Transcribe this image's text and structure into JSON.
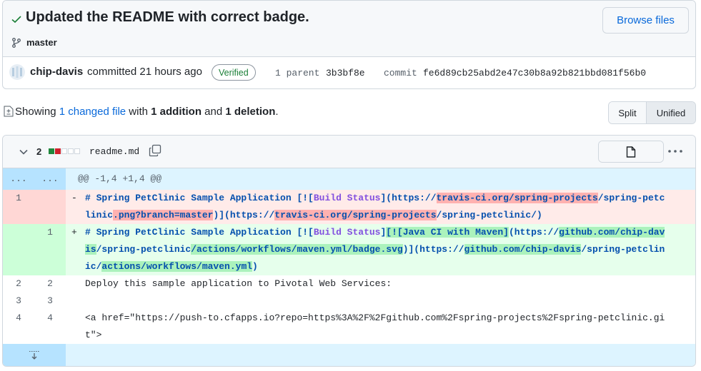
{
  "commit": {
    "title": "Updated the README with correct badge.",
    "browse_label": "Browse files",
    "branch": "master",
    "author": "chip-davis",
    "committed_text": "committed 21 hours ago",
    "verified_label": "Verified",
    "parent_label": "1 parent",
    "parent_sha": "3b3bf8e",
    "commit_label": "commit",
    "commit_sha": "fe6d89cb25abd2e47c30b8a92b821bbd081f56b0"
  },
  "summary": {
    "showing": "Showing",
    "changed_files": "1 changed file",
    "with": "with",
    "additions": "1 addition",
    "and": "and",
    "deletions": "1 deletion",
    "period": "."
  },
  "view_toggle": {
    "split": "Split",
    "unified": "Unified",
    "selected": "Unified"
  },
  "file": {
    "change_count": "2",
    "name": "readme.md",
    "hunk_dots_left": "...",
    "hunk_dots_right": "...",
    "hunk_header": "@@ -1,4 +1,4 @@",
    "deleted_line": {
      "old_num": "1",
      "marker": "-"
    },
    "added_line": {
      "new_num": "1",
      "marker": "+"
    },
    "context_lines": [
      {
        "old": "2",
        "new": "2",
        "text": "Deploy this sample application to Pivotal Web Services:"
      },
      {
        "old": "3",
        "new": "3",
        "text": ""
      },
      {
        "old": "4",
        "new": "4",
        "text": "<a href=\"https://push-to.cfapps.io?repo=https%3A%2F%2Fgithub.com%2Fspring-projects%2Fspring-petclinic.git\">"
      }
    ],
    "del_parts": [
      "# Spring PetClinic Sample Application [![",
      "Build Status",
      "](https://",
      "travis-ci.org/spring-projects",
      "/spring-petclinic",
      ".png?branch=master",
      ")](https://",
      "travis-ci.org/spring-projects",
      "/spring-petclinic/)"
    ],
    "add_parts": [
      "# Spring PetClinic Sample Application [![",
      "Build Status",
      "]",
      "[![Java CI with Maven]",
      "(https://",
      "github.com/chip-davis",
      "/spring-petclinic",
      "/actions/workflows/maven.yml/badge.svg",
      ")](https://",
      "github.com/chip-davis",
      "/spring-petclinic/",
      "actions/workflows/maven.yml",
      ")"
    ]
  },
  "colors": {
    "accent": "#0969da",
    "verified": "#1a7f37",
    "addition": "#1f883d",
    "deletion": "#cf222e"
  }
}
